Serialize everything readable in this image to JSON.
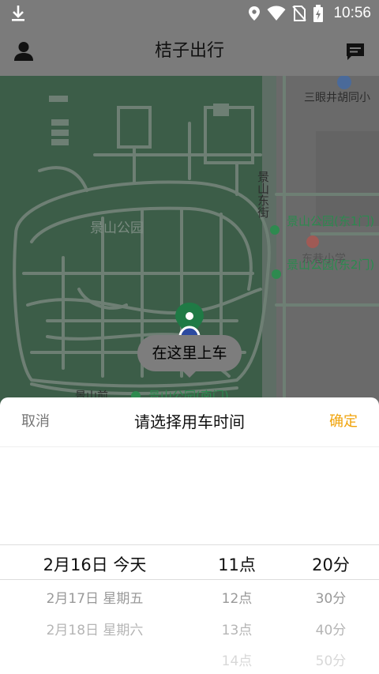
{
  "status": {
    "time": "10:56"
  },
  "header": {
    "title": "桔子出行"
  },
  "map": {
    "park_label": "景山公园",
    "street_label": "景山东街",
    "poi_top": "三眼井胡同小",
    "poi_east1": "景山公园(东1门)",
    "poi_east2": "景山公园(东2门)",
    "poi_south": "景山公园(南门)",
    "road_south": "景山前",
    "poi_faded": "东巷小学",
    "callout": "在这里上车"
  },
  "picker": {
    "cancel": "取消",
    "title": "请选择用车时间",
    "confirm": "确定",
    "dates": [
      "2月16日 今天",
      "2月17日 星期五",
      "2月18日 星期六"
    ],
    "hours": [
      "11点",
      "12点",
      "13点",
      "14点"
    ],
    "minutes": [
      "20分",
      "30分",
      "40分",
      "50分"
    ]
  }
}
